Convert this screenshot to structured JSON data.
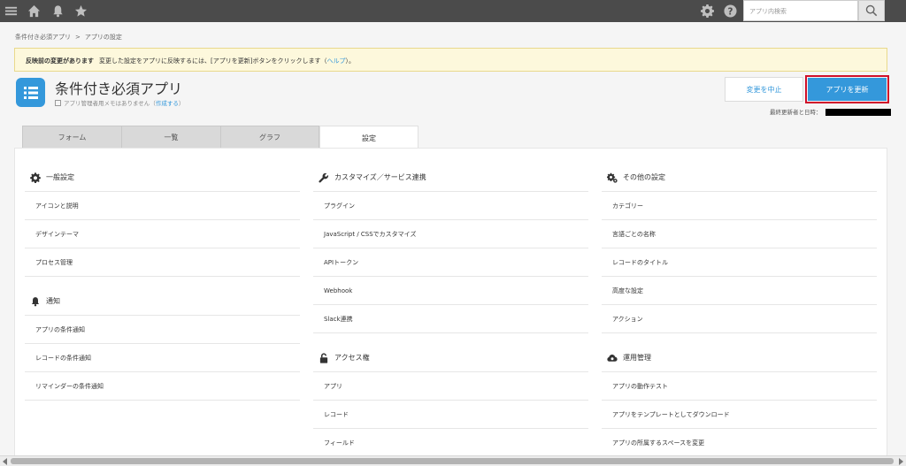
{
  "topbar": {
    "icons": [
      "menu-icon",
      "home-icon",
      "bell-icon",
      "star-icon",
      "gear-icon",
      "help-icon",
      "search-icon"
    ],
    "search_placeholder": "アプリ内検索"
  },
  "breadcrumb": {
    "app_name": "条件付き必須アプリ",
    "separator": ">",
    "current": "アプリの設定"
  },
  "notice": {
    "title": "反映前の変更があります",
    "message": "変更した設定をアプリに反映するには、[アプリを更新]ボタンをクリックします",
    "help_open": "（",
    "help_link": "ヘルプ",
    "help_close": "）。"
  },
  "app": {
    "title": "条件付き必須アプリ",
    "memo": "アプリ管理者用メモはありません",
    "memo_create_open": "（",
    "memo_create": "作成する",
    "memo_create_close": "）",
    "cancel_label": "変更を中止",
    "update_label": "アプリを更新",
    "last_updated_label": "最終更新者と日時："
  },
  "tabs": [
    {
      "label": "フォーム",
      "active": false
    },
    {
      "label": "一覧",
      "active": false
    },
    {
      "label": "グラフ",
      "active": false
    },
    {
      "label": "設定",
      "active": true
    }
  ],
  "columns": [
    {
      "sections": [
        {
          "icon": "gear-icon",
          "title": "一般設定",
          "items": [
            "アイコンと説明",
            "デザインテーマ",
            "プロセス管理"
          ]
        },
        {
          "icon": "bell-icon",
          "title": "通知",
          "items": [
            "アプリの条件通知",
            "レコードの条件通知",
            "リマインダーの条件通知"
          ]
        }
      ]
    },
    {
      "sections": [
        {
          "icon": "wrench-icon",
          "title": "カスタマイズ／サービス連携",
          "items": [
            "プラグイン",
            "JavaScript / CSSでカスタマイズ",
            "APIトークン",
            "Webhook",
            "Slack連携"
          ]
        },
        {
          "icon": "lock-icon",
          "title": "アクセス権",
          "items": [
            "アプリ",
            "レコード",
            "フィールド"
          ]
        }
      ]
    },
    {
      "sections": [
        {
          "icon": "gears-icon",
          "title": "その他の設定",
          "items": [
            "カテゴリー",
            "言語ごとの名称",
            "レコードのタイトル",
            "高度な設定",
            "アクション"
          ]
        },
        {
          "icon": "cloud-gear-icon",
          "title": "運用管理",
          "items": [
            "アプリの動作テスト",
            "アプリをテンプレートとしてダウンロード",
            "アプリの所属するスペースを変更"
          ]
        }
      ]
    }
  ],
  "colors": {
    "accent": "#3498db",
    "topbar": "#4b4b4b",
    "highlight_border": "#d0102a",
    "notice_bg": "#fdf8dc"
  }
}
